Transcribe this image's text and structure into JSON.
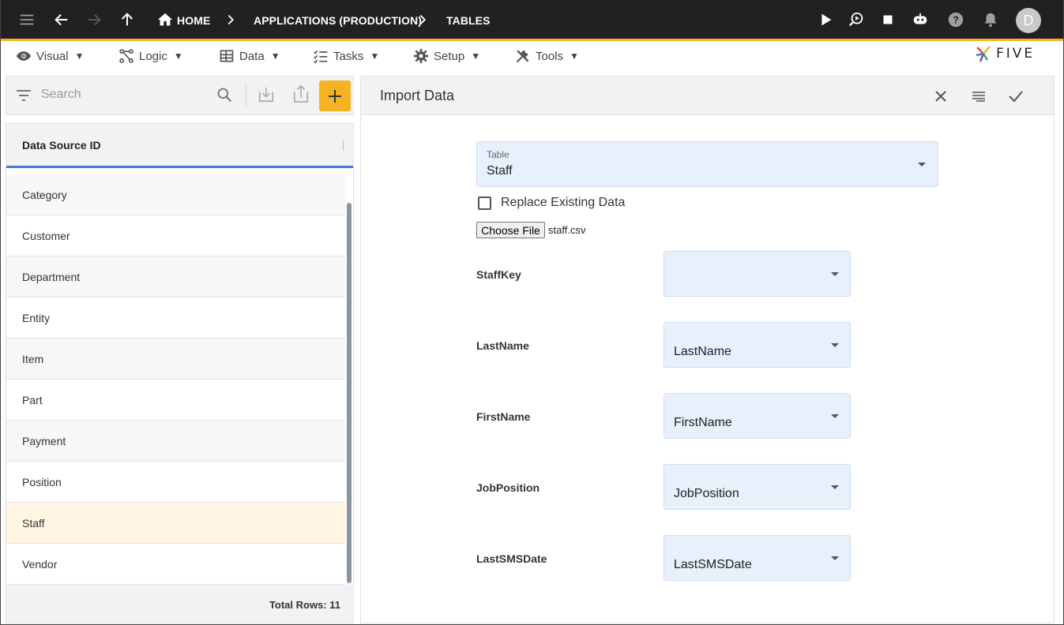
{
  "topbar": {
    "breadcrumbs": [
      "HOME",
      "APPLICATIONS (PRODUCTION)",
      "TABLES"
    ],
    "avatar_initial": "D",
    "accent_color": "#f5b324"
  },
  "menu": {
    "items": [
      {
        "label": "Visual",
        "icon": "eye-icon"
      },
      {
        "label": "Logic",
        "icon": "flow-icon"
      },
      {
        "label": "Data",
        "icon": "table-icon"
      },
      {
        "label": "Tasks",
        "icon": "checklist-icon"
      },
      {
        "label": "Setup",
        "icon": "gear-icon"
      },
      {
        "label": "Tools",
        "icon": "tools-icon"
      }
    ],
    "caret": "▼",
    "logo_text": "FIVE"
  },
  "list": {
    "search_placeholder": "Search",
    "column_header": "Data Source ID",
    "rows": [
      "Category",
      "Customer",
      "Department",
      "Entity",
      "Item",
      "Part",
      "Payment",
      "Position",
      "Staff",
      "Vendor"
    ],
    "selected": "Staff",
    "total_rows": "Total Rows: 11"
  },
  "form": {
    "title": "Import Data",
    "table_label": "Table",
    "table_value": "Staff",
    "replace_label": "Replace Existing Data",
    "replace_checked": false,
    "choose_file_label": "Choose File",
    "file_name": "staff.csv",
    "mappings": [
      {
        "field": "StaffKey",
        "value": ""
      },
      {
        "field": "LastName",
        "value": "LastName"
      },
      {
        "field": "FirstName",
        "value": "FirstName"
      },
      {
        "field": "JobPosition",
        "value": "JobPosition"
      },
      {
        "field": "LastSMSDate",
        "value": "LastSMSDate"
      }
    ]
  }
}
